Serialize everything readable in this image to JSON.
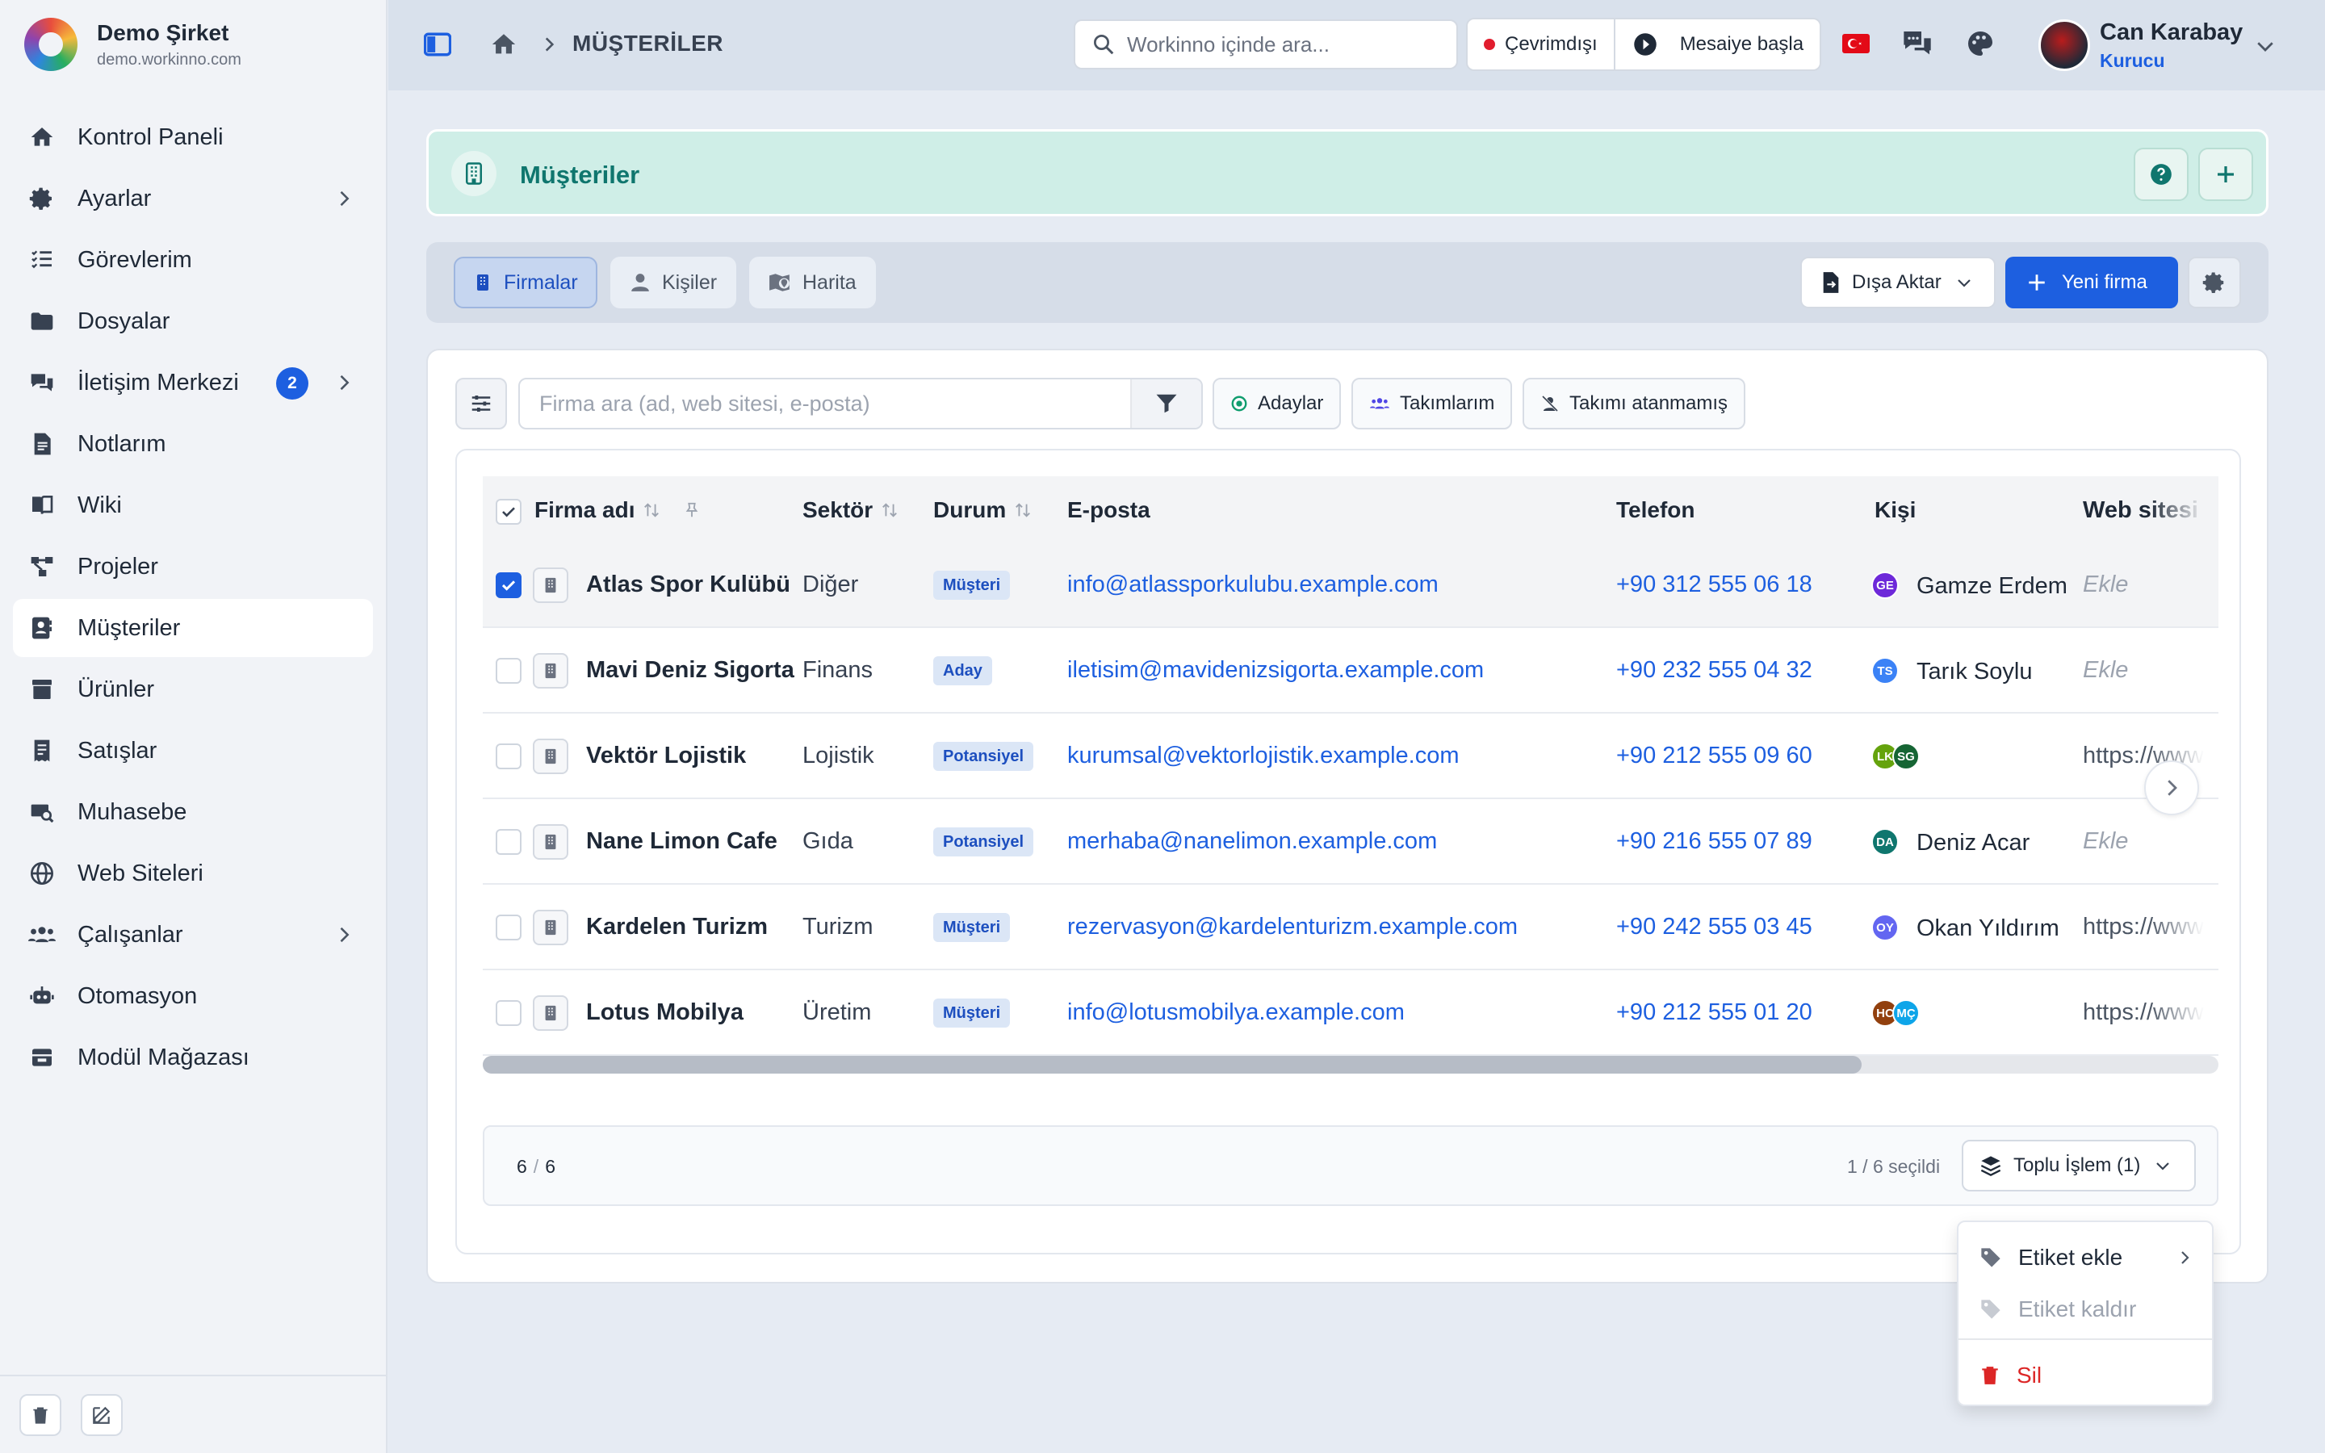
{
  "sidebar": {
    "company_name": "Demo Şirket",
    "company_domain": "demo.workinno.com",
    "items": [
      {
        "label": "Kontrol Paneli"
      },
      {
        "label": "Ayarlar"
      },
      {
        "label": "Görevlerim"
      },
      {
        "label": "Dosyalar"
      },
      {
        "label": "İletişim Merkezi",
        "badge": "2"
      },
      {
        "label": "Notlarım"
      },
      {
        "label": "Wiki"
      },
      {
        "label": "Projeler"
      },
      {
        "label": "Müşteriler"
      },
      {
        "label": "Ürünler"
      },
      {
        "label": "Satışlar"
      },
      {
        "label": "Muhasebe"
      },
      {
        "label": "Web Siteleri"
      },
      {
        "label": "Çalışanlar"
      },
      {
        "label": "Otomasyon"
      },
      {
        "label": "Modül Mağazası"
      }
    ]
  },
  "topbar": {
    "breadcrumb": "MÜŞTERİLER",
    "search_placeholder": "Workinno içinde ara...",
    "status": "Çevrimdışı",
    "start_shift": "Mesaiye başla",
    "user_name": "Can Karabay",
    "user_role": "Kurucu"
  },
  "page": {
    "title": "Müşteriler"
  },
  "tabs": [
    {
      "label": "Firmalar"
    },
    {
      "label": "Kişiler"
    },
    {
      "label": "Harita"
    }
  ],
  "actions": {
    "export": "Dışa Aktar",
    "new_company": "Yeni firma"
  },
  "filters": {
    "search_placeholder": "Firma ara (ad, web sitesi, e-posta)",
    "chips": [
      "Adaylar",
      "Takımlarım",
      "Takımı atanmamış"
    ]
  },
  "table": {
    "columns": [
      "Firma adı",
      "Sektör",
      "Durum",
      "E-posta",
      "Telefon",
      "Kişi",
      "Web sitesi"
    ],
    "rows": [
      {
        "name": "Atlas Spor Kulübü",
        "sector": "Diğer",
        "status": "Müşteri",
        "email": "info@atlassporkulubu.example.com",
        "phone": "+90 312 555 06 18",
        "people": [
          {
            "initials": "GE",
            "color": "#6d28d9"
          }
        ],
        "person": "Gamze Erdem",
        "web": "Ekle",
        "selected": true
      },
      {
        "name": "Mavi Deniz Sigorta",
        "sector": "Finans",
        "status": "Aday",
        "email": "iletisim@mavidenizsigorta.example.com",
        "phone": "+90 232 555 04 32",
        "people": [
          {
            "initials": "TS",
            "color": "#3b82f6"
          }
        ],
        "person": "Tarık Soylu",
        "web": "Ekle",
        "selected": false
      },
      {
        "name": "Vektör Lojistik",
        "sector": "Lojistik",
        "status": "Potansiyel",
        "email": "kurumsal@vektorlojistik.example.com",
        "phone": "+90 212 555 09 60",
        "people": [
          {
            "initials": "LK",
            "color": "#65a30d"
          },
          {
            "initials": "SG",
            "color": "#166534"
          }
        ],
        "person": "",
        "web": "https://www.vektorlojistik.example.com",
        "selected": false
      },
      {
        "name": "Nane Limon Cafe",
        "sector": "Gıda",
        "status": "Potansiyel",
        "email": "merhaba@nanelimon.example.com",
        "phone": "+90 216 555 07 89",
        "people": [
          {
            "initials": "DA",
            "color": "#0f766e"
          }
        ],
        "person": "Deniz Acar",
        "web": "Ekle",
        "selected": false
      },
      {
        "name": "Kardelen Turizm",
        "sector": "Turizm",
        "status": "Müşteri",
        "email": "rezervasyon@kardelenturizm.example.com",
        "phone": "+90 242 555 03 45",
        "people": [
          {
            "initials": "OY",
            "color": "#6366f1"
          }
        ],
        "person": "Okan Yıldırım",
        "web": "https://www.kardelenturizm.example.com",
        "selected": false
      },
      {
        "name": "Lotus Mobilya",
        "sector": "Üretim",
        "status": "Müşteri",
        "email": "info@lotusmobilya.example.com",
        "phone": "+90 212 555 01 20",
        "people": [
          {
            "initials": "HC",
            "color": "#92400e"
          },
          {
            "initials": "MÇ",
            "color": "#0ea5e9"
          }
        ],
        "person": "",
        "web": "https://www.lotusmobilya.example.com",
        "selected": false
      }
    ]
  },
  "footer": {
    "shown": "6",
    "total": "6",
    "selected_text": "1 / 6 seçildi",
    "bulk_action": "Toplu İşlem (1)"
  },
  "bulk_menu": {
    "add_tag": "Etiket ekle",
    "remove_tag": "Etiket kaldır",
    "delete": "Sil"
  },
  "colors": {
    "accent": "#1d5fe0",
    "teal": "#0f766e",
    "danger": "#dc2626",
    "offline": "#e11d2e"
  }
}
